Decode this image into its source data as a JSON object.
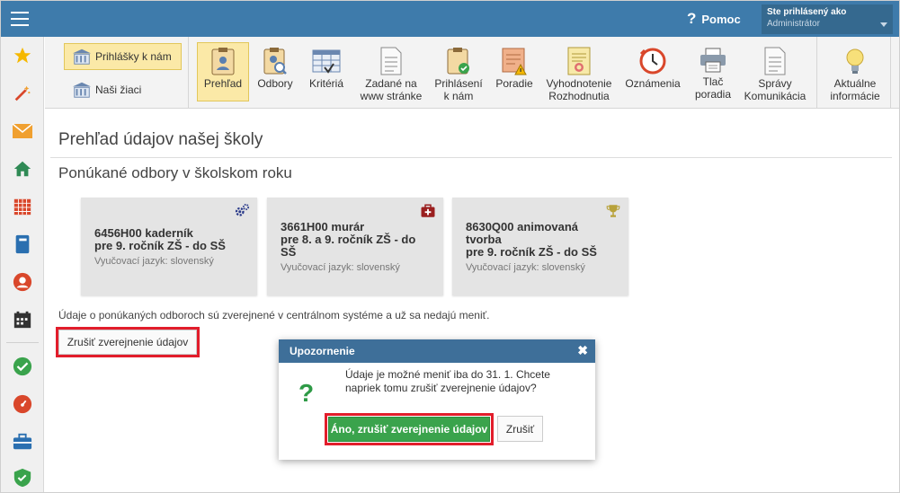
{
  "header": {
    "help_label": "Pomoc",
    "user_label": "Ste prihlásený ako",
    "user_name": "Administrátor"
  },
  "sidebar": {
    "icons": [
      "star-icon",
      "magic-wand-icon",
      "envelope-icon",
      "home-icon",
      "calendar-grid-icon",
      "notebook-icon",
      "user-icon",
      "schedule-icon",
      "check-icon",
      "gauge-icon",
      "briefcase-icon",
      "shield-icon"
    ]
  },
  "ribbon": {
    "side_buttons": [
      {
        "label": "Prihlášky k nám",
        "active": true
      },
      {
        "label": "Naši žiaci",
        "active": false
      }
    ],
    "buttons": [
      {
        "line1": "Prehľad",
        "line2": "",
        "active": true
      },
      {
        "line1": "Odbory",
        "line2": "",
        "active": false
      },
      {
        "line1": "Kritériá",
        "line2": "",
        "active": false
      },
      {
        "line1": "Zadané na",
        "line2": "www stránke",
        "active": false
      },
      {
        "line1": "Prihlásení",
        "line2": "k nám",
        "active": false
      },
      {
        "line1": "Poradie",
        "line2": "",
        "active": false
      },
      {
        "line1": "Vyhodnotenie",
        "line2": "Rozhodnutia",
        "active": false
      },
      {
        "line1": "Oznámenia",
        "line2": "",
        "active": false
      },
      {
        "line1": "Tlač",
        "line2": "poradia",
        "active": false
      },
      {
        "line1": "Správy",
        "line2": "Komunikácia",
        "active": false
      },
      {
        "line1": "Aktuálne",
        "line2": "informácie",
        "active": false
      }
    ]
  },
  "main": {
    "title": "Prehľad údajov našej školy",
    "subtitle": "Ponúkané odbory v školskom roku",
    "cards": [
      {
        "line1": "6456H00 kaderník",
        "line2": "pre 9. ročník ZŠ - do SŠ",
        "lang": "Vyučovací jazyk: slovenský",
        "icon": "gears-icon"
      },
      {
        "line1": "3661H00 murár",
        "line2": "pre 8. a 9. ročník ZŠ - do SŠ",
        "lang": "Vyučovací jazyk: slovenský",
        "icon": "first-aid-icon"
      },
      {
        "line1": "8630Q00 animovaná tvorba",
        "line2": "pre 9. ročník ZŠ - do SŠ",
        "lang": "Vyučovací jazyk: slovenský",
        "icon": "trophy-icon"
      }
    ],
    "info_text": "Údaje o ponúkaných odboroch sú zverejnené v centrálnom systéme a už sa nedajú meniť.",
    "cancel_publish_label": "Zrušiť zverejnenie údajov"
  },
  "modal": {
    "title": "Upozornenie",
    "message": "Údaje je možné meniť iba do 31. 1. Chcete napriek tomu zrušiť zverejnenie údajov?",
    "confirm_label": "Áno, zrušiť zverejnenie údajov",
    "cancel_label": "Zrušiť"
  },
  "colors": {
    "topbar": "#3e7bab",
    "highlight": "#e21d2b",
    "confirm": "#3aa34c",
    "active_ribbon": "#fbe9a7"
  }
}
